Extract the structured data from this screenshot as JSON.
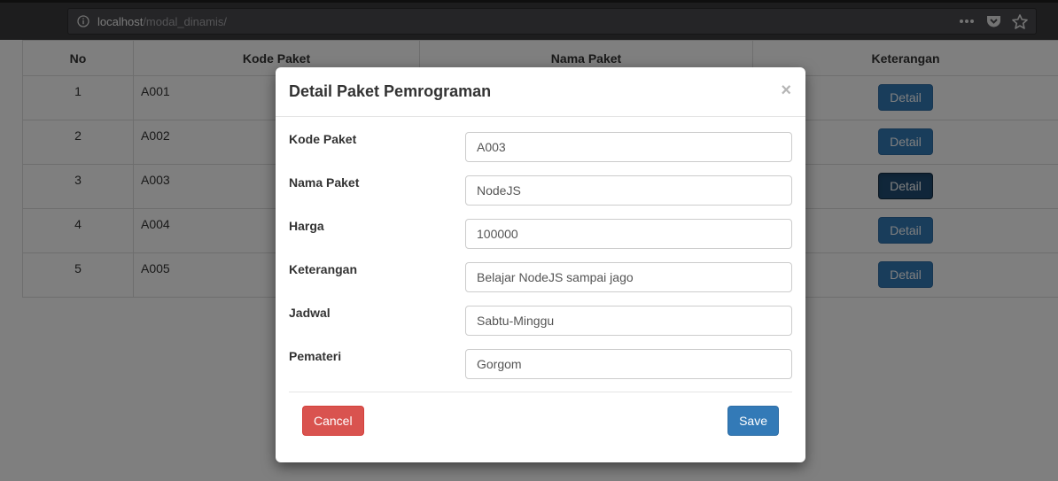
{
  "browser": {
    "url_host": "localhost",
    "url_path": "/modal_dinamis/"
  },
  "table": {
    "headers": [
      "No",
      "Kode Paket",
      "Nama Paket",
      "Keterangan"
    ],
    "rows": [
      {
        "no": "1",
        "kode": "A001",
        "action": "Detail"
      },
      {
        "no": "2",
        "kode": "A002",
        "action": "Detail"
      },
      {
        "no": "3",
        "kode": "A003",
        "action": "Detail"
      },
      {
        "no": "4",
        "kode": "A004",
        "action": "Detail"
      },
      {
        "no": "5",
        "kode": "A005",
        "action": "Detail"
      }
    ]
  },
  "modal": {
    "title": "Detail Paket Pemrograman",
    "close": "×",
    "fields": [
      {
        "label": "Kode Paket",
        "value": "A003"
      },
      {
        "label": "Nama Paket",
        "value": "NodeJS"
      },
      {
        "label": "Harga",
        "value": "100000"
      },
      {
        "label": "Keterangan",
        "value": "Belajar NodeJS sampai jago"
      },
      {
        "label": "Jadwal",
        "value": "Sabtu-Minggu"
      },
      {
        "label": "Pemateri",
        "value": "Gorgom"
      }
    ],
    "cancel_label": "Cancel",
    "save_label": "Save"
  },
  "colors": {
    "primary": "#337ab7",
    "danger": "#d9534f"
  },
  "icons": [
    "info-icon",
    "more-icon",
    "pocket-icon",
    "bookmark-star-icon",
    "close-icon"
  ]
}
